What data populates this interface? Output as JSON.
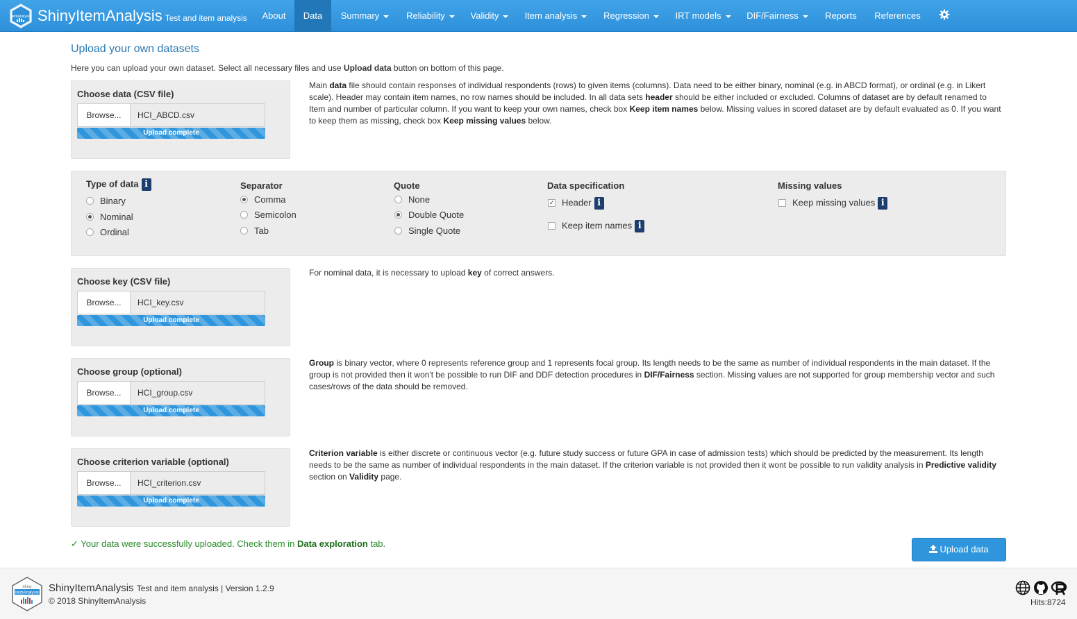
{
  "navbar": {
    "brand": "ShinyItemAnalysis",
    "brand_sub": "Test and item analysis",
    "logo_text": "itemAnalysis",
    "items": [
      {
        "label": "About"
      },
      {
        "label": "Data"
      },
      {
        "label": "Summary"
      },
      {
        "label": "Reliability"
      },
      {
        "label": "Validity"
      },
      {
        "label": "Item analysis"
      },
      {
        "label": "Regression"
      },
      {
        "label": "IRT models"
      },
      {
        "label": "DIF/Fairness"
      },
      {
        "label": "Reports"
      },
      {
        "label": "References"
      }
    ],
    "active": "Data",
    "settings_icon": "gear-icon"
  },
  "page": {
    "title": "Upload your own datasets",
    "intro_pre": "Here you can upload your own dataset. Select all necessary files and use ",
    "intro_bold": "Upload data",
    "intro_post": " button on bottom of this page."
  },
  "uploads": [
    {
      "title": "Choose data (CSV file)",
      "browse": "Browse...",
      "file": "HCI_ABCD.csv",
      "progress": "Upload complete",
      "progress_value": 1.0
    },
    {
      "title": "Choose key (CSV file)",
      "browse": "Browse...",
      "file": "HCI_key.csv",
      "progress": "Upload complete",
      "progress_value": 1.0
    },
    {
      "title": "Choose group (optional)",
      "browse": "Browse...",
      "file": "HCI_group.csv",
      "progress": "Upload complete",
      "progress_value": 1.0
    },
    {
      "title": "Choose criterion variable (optional)",
      "browse": "Browse...",
      "file": "HCI_criterion.csv",
      "progress": "Upload complete",
      "progress_value": 1.0
    }
  ],
  "descriptions": {
    "data": [
      {
        "t": "Main "
      },
      {
        "b": "data"
      },
      {
        "t": " file should contain responses of individual respondents (rows) to given items (columns). Data need to be either binary, nominal (e.g. in ABCD format), or ordinal (e.g. in Likert scale). Header may contain item names, no row names should be included. In all data sets "
      },
      {
        "b": "header"
      },
      {
        "t": " should be either included or excluded. Columns of dataset are by default renamed to Item and number of particular column. If you want to keep your own names, check box "
      },
      {
        "b": "Keep item names"
      },
      {
        "t": " below. Missing values in scored dataset are by default evaluated as 0. If you want to keep them as missing, check box "
      },
      {
        "b": "Keep missing values"
      },
      {
        "t": " below."
      }
    ],
    "key": [
      {
        "t": "For nominal data, it is necessary to upload "
      },
      {
        "b": "key"
      },
      {
        "t": " of correct answers."
      }
    ],
    "group": [
      {
        "b": "Group"
      },
      {
        "t": " is binary vector, where 0 represents reference group and 1 represents focal group. Its length needs to be the same as number of individual respondents in the main dataset. If the group is not provided then it won't be possible to run DIF and DDF detection procedures in "
      },
      {
        "b": "DIF/Fairness"
      },
      {
        "t": " section. Missing values are not supported for group membership vector and such cases/rows of the data should be removed."
      }
    ],
    "criterion": [
      {
        "b": "Criterion variable"
      },
      {
        "t": " is either discrete or continuous vector (e.g. future study success or future GPA in case of admission tests) which should be predicted by the measurement. Its length needs to be the same as number of individual respondents in the main dataset. If the criterion variable is not provided then it wont be possible to run validity analysis in "
      },
      {
        "b": "Predictive validity"
      },
      {
        "t": " section on "
      },
      {
        "b": "Validity"
      },
      {
        "t": " page."
      }
    ]
  },
  "settings": {
    "type_of_data": {
      "label": "Type of data",
      "options": [
        "Binary",
        "Nominal",
        "Ordinal"
      ],
      "selected": "Nominal"
    },
    "separator": {
      "label": "Separator",
      "options": [
        "Comma",
        "Semicolon",
        "Tab"
      ],
      "selected": "Comma"
    },
    "quote": {
      "label": "Quote",
      "options": [
        "None",
        "Double Quote",
        "Single Quote"
      ],
      "selected": "Double Quote"
    },
    "data_spec": {
      "label": "Data specification",
      "header": "Header",
      "header_checked": true,
      "keep_names": "Keep item names",
      "keep_names_checked": false
    },
    "missing": {
      "label": "Missing values",
      "keep_missing": "Keep missing values",
      "keep_missing_checked": false
    }
  },
  "success": {
    "check": "✓",
    "pre": " Your data were successfully uploaded. Check them in ",
    "bold": "Data exploration",
    "post": " tab."
  },
  "upload_button": "Upload data",
  "footer": {
    "brand": "ShinyItemAnalysis",
    "version": "Test and item analysis | Version 1.2.9",
    "copyright": "© 2018 ShinyItemAnalysis",
    "logo_top": "Shiny",
    "logo_text": "itemAnalysis",
    "hits": "Hits:8724",
    "icons": [
      "globe-icon",
      "github-icon",
      "r-project-icon"
    ]
  },
  "colors": {
    "navbar": "#2e90d9",
    "navbar_active": "#2177b7",
    "title": "#2a7ab3",
    "progress": "#2f96dd",
    "success": "#2a8a2a",
    "info_badge": "#1c3d6e"
  }
}
